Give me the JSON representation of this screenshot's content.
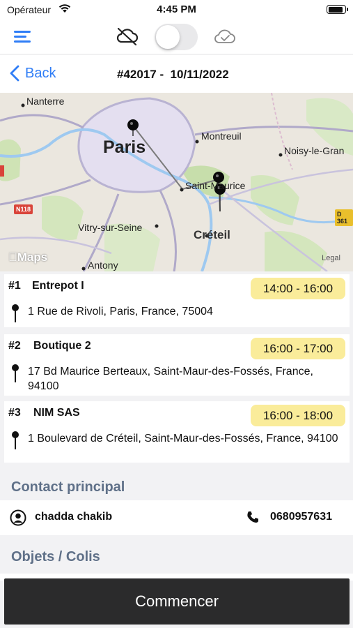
{
  "status_bar": {
    "carrier": "Opérateur",
    "time": "4:45 PM"
  },
  "toolbar": {
    "sync_enabled": false
  },
  "nav": {
    "back_label": "Back",
    "title": "#42017 -  10/11/2022"
  },
  "map": {
    "labels": {
      "nanterre": "Nanterre",
      "paris": "Paris",
      "montreuil": "Montreuil",
      "noisy": "Noisy-le-Gran",
      "saint_maurice": "Saint-Maurice",
      "vitry": "Vitry-sur-Seine",
      "creteil": "Créteil",
      "antony": "Antony"
    },
    "road_n118": "N118",
    "road_d361": "D 361",
    "maps_logo": "Maps",
    "legal": "Legal"
  },
  "stops": [
    {
      "num": "#1",
      "name": "Entrepot I",
      "time": "14:00 - 16:00",
      "address": "1 Rue de Rivoli, Paris, France, 75004"
    },
    {
      "num": "#2",
      "name": "Boutique 2",
      "time": "16:00 - 17:00",
      "address": "17 Bd Maurice Berteaux, Saint-Maur-des-Fossés, France, 94100"
    },
    {
      "num": "#3",
      "name": "NIM SAS",
      "time": "16:00 - 18:00",
      "address": "1 Boulevard de Créteil, Saint-Maur-des-Fossés, France, 94100"
    }
  ],
  "contact": {
    "section_title": "Contact principal",
    "name": "chadda chakib",
    "phone": "0680957631"
  },
  "objects": {
    "section_title": "Objets / Colis"
  },
  "start_button": "Commencer",
  "colors": {
    "accent": "#2f7df6",
    "time_badge": "#faec9a",
    "section_title": "#5f7088",
    "button": "#2b2b2c"
  }
}
